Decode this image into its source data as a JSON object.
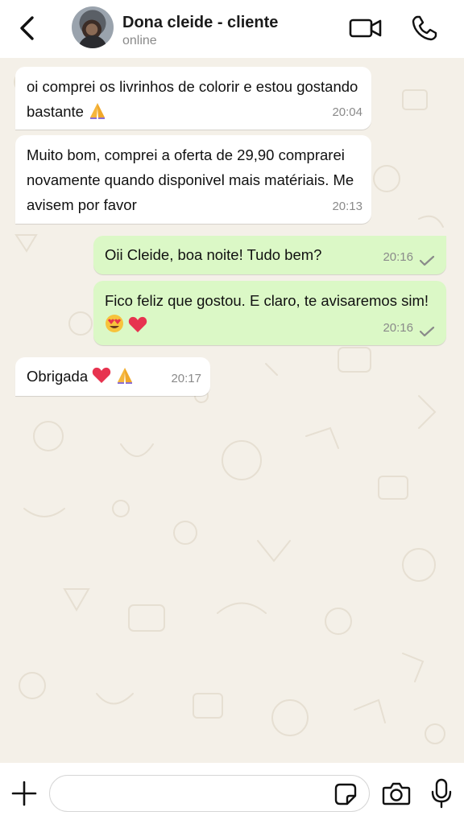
{
  "header": {
    "contact_name": "Dona cleide - cliente",
    "status": "online"
  },
  "messages": [
    {
      "direction": "incoming",
      "text": "oi comprei os livrinhos de colorir e estou gostando bastante",
      "emoji": [
        "folded-hands"
      ],
      "time": "20:04"
    },
    {
      "direction": "incoming",
      "text": "Muito bom, comprei a oferta de 29,90 comprarei novamente quando disponivel mais matériais. Me avisem por favor",
      "time": "20:13"
    },
    {
      "direction": "outgoing",
      "text": "Oii Cleide, boa noite! Tudo bem?",
      "time": "20:16",
      "status": "sent"
    },
    {
      "direction": "outgoing",
      "text": "Fico feliz que gostou. E claro, te avisaremos sim!",
      "emoji": [
        "heart-eyes-face",
        "heart"
      ],
      "time": "20:16",
      "status": "sent"
    },
    {
      "direction": "incoming",
      "text": "Obrigada",
      "emoji": [
        "heart",
        "folded-hands"
      ],
      "time": "20:17"
    }
  ],
  "composer": {
    "value": "",
    "placeholder": ""
  },
  "colors": {
    "outgoing_bubble": "#dbf8c6",
    "incoming_bubble": "#ffffff",
    "wallpaper": "#f4f0e8",
    "tick": "#8a8a8a"
  },
  "icons": {
    "back": "chevron-left-icon",
    "video": "video-camera-icon",
    "call": "phone-icon",
    "plus": "plus-icon",
    "sticker": "sticker-icon",
    "camera": "camera-icon",
    "mic": "microphone-icon"
  }
}
